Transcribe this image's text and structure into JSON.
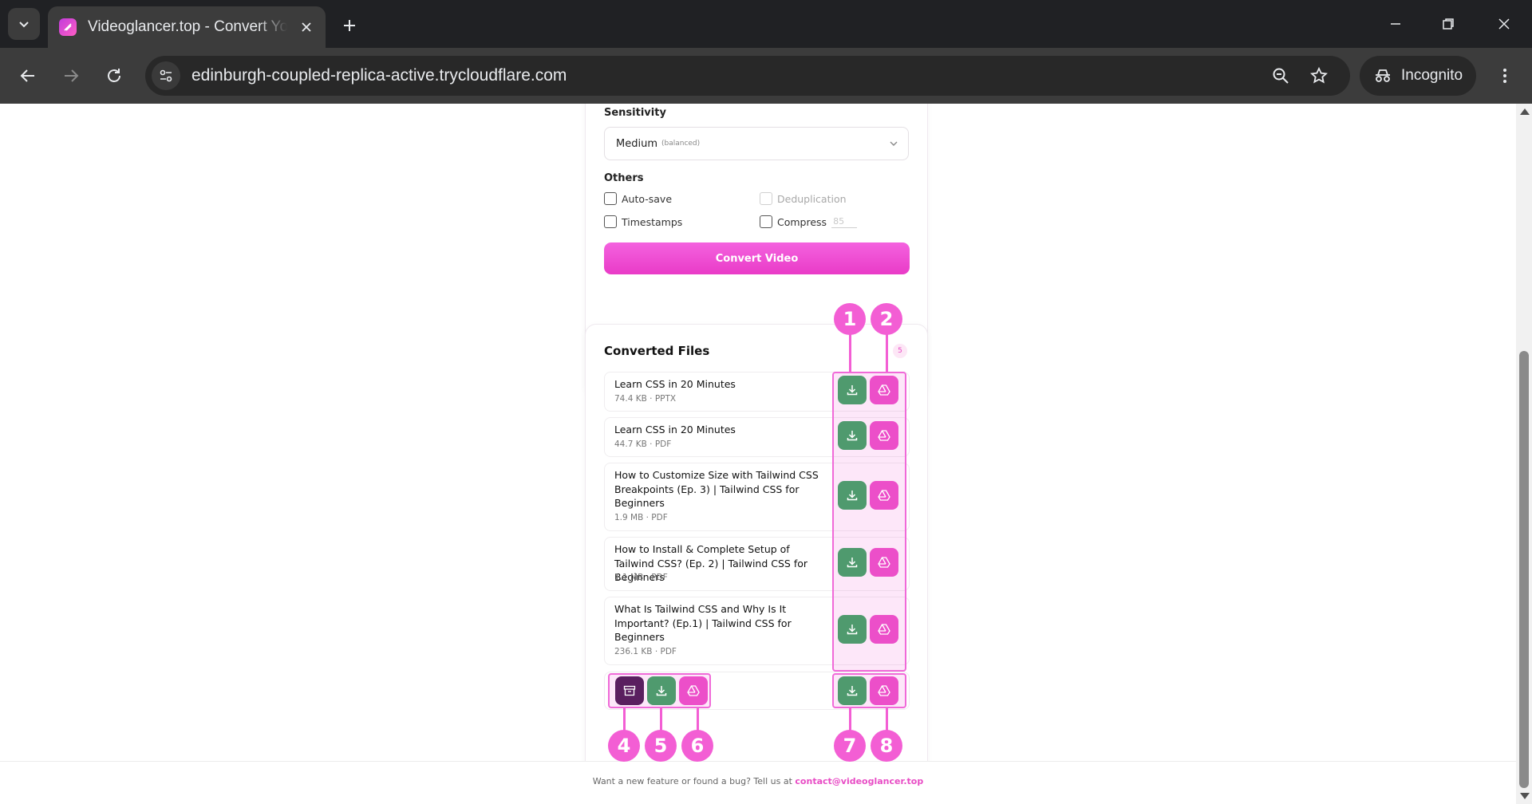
{
  "browser": {
    "tab_title": "Videoglancer.top - Convert YouTube",
    "url": "edinburgh-coupled-replica-active.trycloudflare.com",
    "incognito_label": "Incognito"
  },
  "settings": {
    "sensitivity_label": "Sensitivity",
    "sensitivity_value": "Medium",
    "sensitivity_sub": "(balanced)",
    "others_label": "Others",
    "autosave_label": "Auto-save",
    "dedup_label": "Deduplication",
    "timestamps_label": "Timestamps",
    "compress_label": "Compress",
    "compress_value": "85",
    "convert_label": "Convert Video"
  },
  "files": {
    "title": "Converted Files",
    "count": "5",
    "items": [
      {
        "name": "Learn CSS in 20 Minutes",
        "meta": "74.4 KB · PPTX"
      },
      {
        "name": "Learn CSS in 20 Minutes",
        "meta": "44.7 KB · PDF"
      },
      {
        "name": "How to Customize Size with Tailwind CSS Breakpoints (Ep. 3) | Tailwind CSS for Beginners",
        "meta": "1.9 MB · PDF"
      },
      {
        "name": "How to Install & Complete Setup of Tailwind CSS? (Ep. 2) | Tailwind CSS for Beginners",
        "meta": "1.1 MB · PDF"
      },
      {
        "name": "What Is Tailwind CSS and Why Is It Important? (Ep.1) | Tailwind CSS for Beginners",
        "meta": "236.1 KB · PDF"
      }
    ]
  },
  "footer": {
    "text": "Want a new feature or found a bug? Tell us at",
    "email": "contact@videoglancer.top"
  },
  "callouts": [
    "1",
    "2",
    "4",
    "5",
    "6",
    "7",
    "8"
  ],
  "icons": {
    "download": "download-icon",
    "drive": "google-drive-icon",
    "archive": "archive-icon"
  },
  "colors": {
    "accent": "#ec4fc9",
    "download_green": "#4f9a6e",
    "archive_purple": "#5a1f5f",
    "callout_pink": "#f35ed4"
  }
}
